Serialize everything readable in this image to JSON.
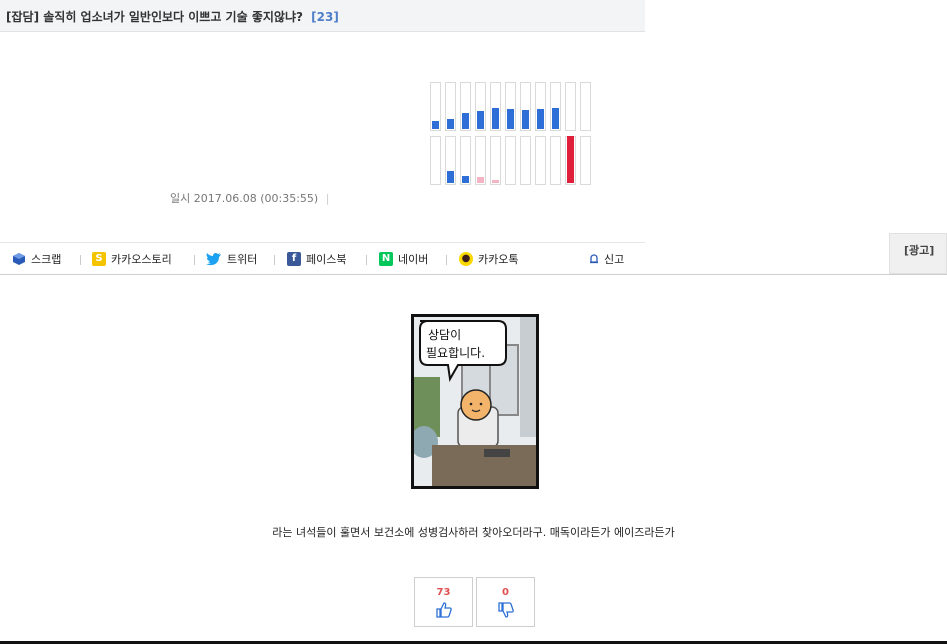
{
  "post": {
    "category": "[잡담]",
    "title": "솔직히 업소녀가 일반인보다 이쁘고 기술 좋지않냐?",
    "comment_count": "[23]",
    "date_label": "일시",
    "date_value": "2017.06.08 (00:35:55)",
    "body_text": "라는 녀석들이 훌면서 보건소에 성병검사하러 찾아오더라구. 매독이라든가 에이즈라든가"
  },
  "vote_graph": {
    "up_color": "#2d6fd6",
    "down_color": "#2d6fd6",
    "faint_color": "#f4b4c4",
    "highlight_color": "#e0203a",
    "up_levels": [
      0.18,
      0.22,
      0.35,
      0.38,
      0.45,
      0.42,
      0.4,
      0.42,
      0.45,
      0,
      0
    ],
    "down_levels": [
      0,
      0.25,
      0.15,
      0.12,
      0.06,
      0,
      0,
      0,
      0,
      1.0,
      0
    ],
    "down_types": [
      "",
      "blue",
      "blue",
      "faint",
      "faint",
      "",
      "",
      "",
      "",
      "highlight",
      ""
    ]
  },
  "share": {
    "items": [
      {
        "label": "스크랩",
        "icon": "cube-icon",
        "color": "#2a5bb8"
      },
      {
        "label": "카카오스토리",
        "icon": "kakaostory-icon",
        "color": "#f5c400"
      },
      {
        "label": "트위터",
        "icon": "twitter-icon",
        "color": "#1da1f2"
      },
      {
        "label": "페이스북",
        "icon": "facebook-icon",
        "color": "#3b5998"
      },
      {
        "label": "네이버",
        "icon": "naver-icon",
        "color": "#03c75a"
      },
      {
        "label": "카카오톡",
        "icon": "kakaotalk-icon",
        "color": "#f9d800"
      }
    ],
    "report": {
      "label": "신고",
      "icon": "bell-icon"
    }
  },
  "ad": {
    "label": "[광고]"
  },
  "comic": {
    "speech_line1": "상담이",
    "speech_line2": "필요합니다."
  },
  "votes": {
    "up_count": "73",
    "down_count": "0"
  }
}
